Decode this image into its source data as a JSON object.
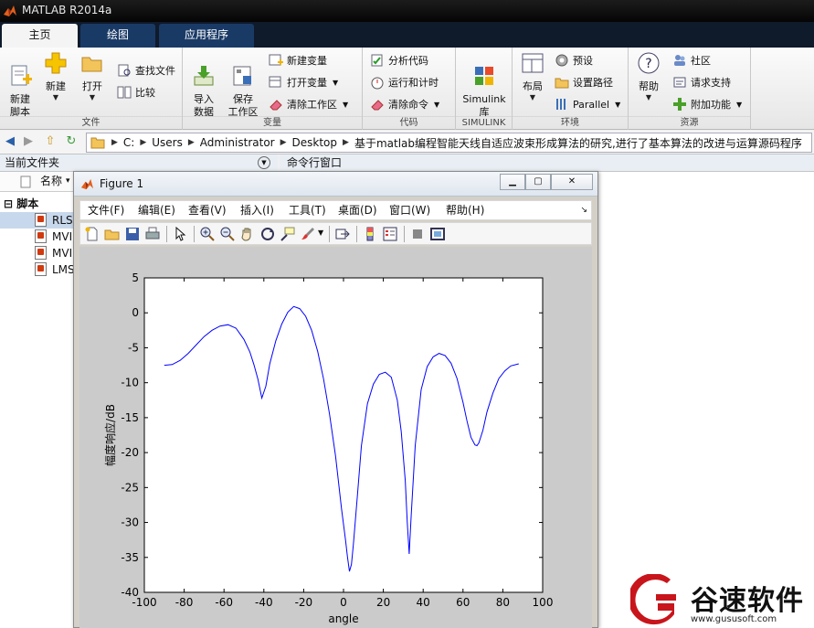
{
  "app": {
    "title": "MATLAB R2014a"
  },
  "tabs": [
    {
      "label": "主页",
      "active": true
    },
    {
      "label": "绘图",
      "active": false
    },
    {
      "label": "应用程序",
      "active": false
    }
  ],
  "ribbon": {
    "groups": {
      "file": "文件",
      "variable": "变量",
      "code": "代码",
      "simulink": "SIMULINK",
      "environment": "环境",
      "resources": "资源"
    },
    "new_script": "新建\n脚本",
    "new": "新建",
    "open": "打开",
    "find_files": "查找文件",
    "compare": "比较",
    "import_data": "导入\n数据",
    "save_workspace": "保存\n工作区",
    "new_variable": "新建变量",
    "open_variable": "打开变量",
    "clear_workspace": "清除工作区",
    "analyze_code": "分析代码",
    "run_and_time": "运行和计时",
    "clear_commands": "清除命令",
    "simulink_library": "Simulink\n库",
    "layout": "布局",
    "preferences": "预设",
    "set_path": "设置路径",
    "parallel": "Parallel",
    "help": "帮助",
    "community": "社区",
    "request_support": "请求支持",
    "add_ons": "附加功能"
  },
  "address": {
    "crumbs": [
      "C:",
      "Users",
      "Administrator",
      "Desktop",
      "基于matlab编程智能天线自适应波束形成算法的研究,进行了基本算法的改进与运算源码程序"
    ]
  },
  "current_folder": {
    "title": "当前文件夹",
    "column_name": "名称",
    "section": "脚本",
    "files": [
      "RLS",
      "MVI",
      "MVI",
      "LMS"
    ],
    "sort_arrow": "▾"
  },
  "command_window": {
    "title": "命令行窗口"
  },
  "figure": {
    "title": "Figure 1",
    "menus": [
      "文件(F)",
      "编辑(E)",
      "查看(V)",
      "插入(I)",
      "工具(T)",
      "桌面(D)",
      "窗口(W)",
      "帮助(H)"
    ],
    "menu_arrow": "↘",
    "tools": [
      "new-figure-icon",
      "open-file-icon",
      "save-icon",
      "print-icon",
      "pointer-icon",
      "zoom-in-icon",
      "zoom-out-icon",
      "pan-hand-icon",
      "rotate-3d-icon",
      "data-cursor-icon",
      "brush-icon",
      "link-plot-icon",
      "colorbar-icon",
      "legend-icon",
      "hide-tools-icon",
      "show-tools-icon"
    ]
  },
  "chart_data": {
    "type": "line",
    "xlabel": "angle",
    "ylabel": "幅度响应/dB",
    "xlim": [
      -100,
      100
    ],
    "ylim": [
      -40,
      5
    ],
    "xticks": [
      -100,
      -80,
      -60,
      -40,
      -20,
      0,
      20,
      40,
      60,
      80,
      100
    ],
    "yticks": [
      5,
      0,
      -5,
      -10,
      -15,
      -20,
      -25,
      -30,
      -35,
      -40
    ],
    "grid": false,
    "line_color": "#0000ff",
    "series": [
      {
        "x": [
          -90,
          -86,
          -82,
          -78,
          -74,
          -70,
          -66,
          -62,
          -58,
          -54,
          -50,
          -47,
          -45,
          -43,
          -41,
          -39,
          -37,
          -34,
          -31,
          -28,
          -25,
          -22,
          -19,
          -16,
          -13,
          -10,
          -7,
          -4,
          -1,
          1,
          2,
          3,
          4,
          5,
          7,
          9,
          12,
          15,
          18,
          21,
          24,
          27,
          29,
          31,
          32,
          33,
          34,
          36,
          39,
          42,
          45,
          48,
          51,
          54,
          57,
          60,
          62,
          64,
          66,
          67,
          68,
          70,
          72,
          75,
          78,
          81,
          84,
          88
        ],
        "y": [
          -7.5,
          -7.4,
          -6.8,
          -5.8,
          -4.6,
          -3.4,
          -2.5,
          -1.9,
          -1.7,
          -2.2,
          -3.8,
          -5.6,
          -7.4,
          -9.5,
          -12.2,
          -10.5,
          -7.3,
          -4.0,
          -1.6,
          0.1,
          0.9,
          0.6,
          -0.5,
          -2.5,
          -5.5,
          -9.5,
          -14.5,
          -20.5,
          -28,
          -32.5,
          -35,
          -37,
          -36,
          -33,
          -26,
          -19,
          -13,
          -10.2,
          -8.8,
          -8.5,
          -9.2,
          -12.5,
          -17,
          -24,
          -30,
          -34.5,
          -29,
          -19,
          -11,
          -7.7,
          -6.3,
          -5.8,
          -6.1,
          -7.2,
          -9.4,
          -12.8,
          -15.5,
          -17.8,
          -18.9,
          -19,
          -18.6,
          -16.8,
          -14.2,
          -11.5,
          -9.4,
          -8.3,
          -7.6,
          -7.3
        ]
      }
    ]
  },
  "watermark": {
    "brand": "谷速软件",
    "url": "www.gususoft.com"
  }
}
